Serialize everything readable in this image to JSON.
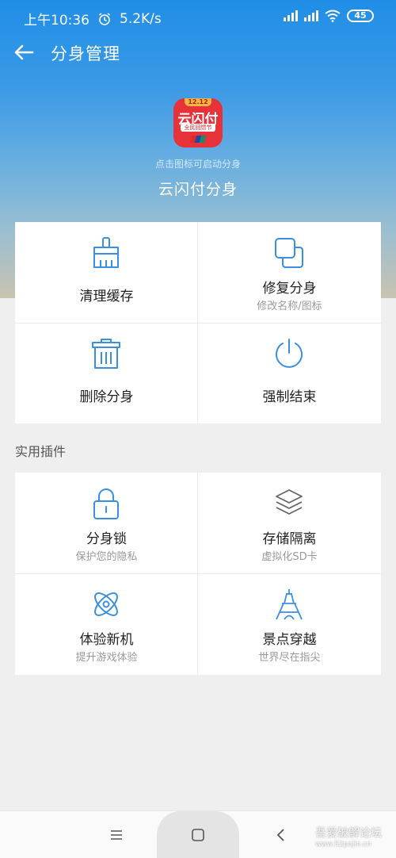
{
  "status": {
    "time": "上午10:36",
    "speed": "5.2K/s",
    "battery": "45"
  },
  "header": {
    "title": "分身管理"
  },
  "app": {
    "icon_badge": "12.12",
    "icon_main": "云闪付",
    "icon_sub": "全民回馈节",
    "hint": "点击图标可启动分身",
    "name": "云闪付分身"
  },
  "actions": [
    {
      "label": "清理缓存",
      "sub": "",
      "icon": "broom-icon"
    },
    {
      "label": "修复分身",
      "sub": "修改名称/图标",
      "icon": "copy-icon"
    },
    {
      "label": "删除分身",
      "sub": "",
      "icon": "trash-icon"
    },
    {
      "label": "强制结束",
      "sub": "",
      "icon": "power-icon"
    }
  ],
  "plugins_section": "实用插件",
  "plugins": [
    {
      "label": "分身锁",
      "sub": "保护您的隐私",
      "icon": "lock-icon"
    },
    {
      "label": "存储隔离",
      "sub": "虚拟化SD卡",
      "icon": "layers-icon"
    },
    {
      "label": "体验新机",
      "sub": "提升游戏体验",
      "icon": "atom-icon"
    },
    {
      "label": "景点穿越",
      "sub": "世界尽在指尖",
      "icon": "eiffel-tower-icon"
    }
  ],
  "watermark": {
    "line1": "吾爱破解论坛",
    "line2": "www.52pojie.cn"
  },
  "colors": {
    "accent": "#3b8fe0",
    "header_blue": "#1f8ee6"
  }
}
